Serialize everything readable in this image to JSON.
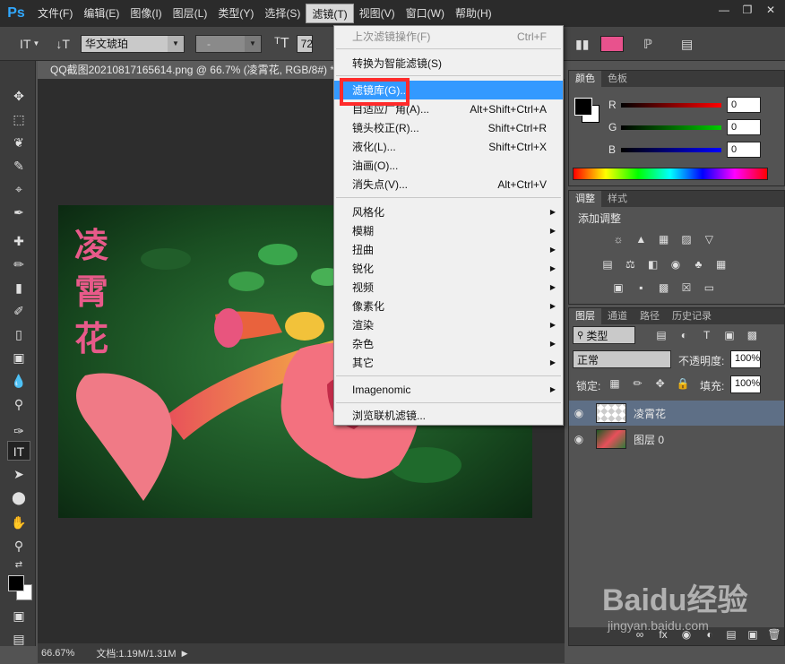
{
  "app": {
    "logo": "Ps",
    "menu": [
      "文件(F)",
      "编辑(E)",
      "图像(I)",
      "图层(L)",
      "类型(Y)",
      "选择(S)",
      "滤镜(T)",
      "视图(V)",
      "窗口(W)",
      "帮助(H)"
    ],
    "active_menu_index": 6,
    "window_controls": [
      "minimize-icon",
      "restore-icon",
      "close-icon"
    ]
  },
  "options_bar": {
    "font_family": "华文琥珀",
    "font_style": "-",
    "font_size": "72"
  },
  "document": {
    "tab_title": "QQ截图20210817165614.png @ 66.7% (凌霄花, RGB/8#) *",
    "overlay_text": "凌霄花",
    "zoom": "66.67%",
    "doc_info": "文档:1.19M/1.31M"
  },
  "filter_menu": {
    "items": [
      {
        "label": "上次滤镜操作(F)",
        "shortcut": "Ctrl+F",
        "disabled": true
      },
      {
        "label": "转换为智能滤镜(S)",
        "shortcut": ""
      },
      {
        "label": "滤镜库(G)...",
        "shortcut": "",
        "highlighted": true
      },
      {
        "label": "自适应广角(A)...",
        "shortcut": "Alt+Shift+Ctrl+A"
      },
      {
        "label": "镜头校正(R)...",
        "shortcut": "Shift+Ctrl+R"
      },
      {
        "label": "液化(L)...",
        "shortcut": "Shift+Ctrl+X"
      },
      {
        "label": "油画(O)...",
        "shortcut": ""
      },
      {
        "label": "消失点(V)...",
        "shortcut": "Alt+Ctrl+V"
      },
      {
        "label": "风格化",
        "submenu": true
      },
      {
        "label": "模糊",
        "submenu": true
      },
      {
        "label": "扭曲",
        "submenu": true
      },
      {
        "label": "锐化",
        "submenu": true
      },
      {
        "label": "视频",
        "submenu": true
      },
      {
        "label": "像素化",
        "submenu": true
      },
      {
        "label": "渲染",
        "submenu": true
      },
      {
        "label": "杂色",
        "submenu": true
      },
      {
        "label": "其它",
        "submenu": true
      },
      {
        "label": "Imagenomic",
        "submenu": true
      },
      {
        "label": "浏览联机滤镜..."
      }
    ]
  },
  "color_panel": {
    "tabs": [
      "颜色",
      "色板"
    ],
    "channels": [
      {
        "label": "R",
        "value": "0",
        "color": "#ff0000"
      },
      {
        "label": "G",
        "value": "0",
        "color": "#00cc00"
      },
      {
        "label": "B",
        "value": "0",
        "color": "#0000ff"
      }
    ]
  },
  "adjust_panel": {
    "tabs": [
      "调整",
      "样式"
    ],
    "title": "添加调整"
  },
  "layers_panel": {
    "tabs": [
      "图层",
      "通道",
      "路径",
      "历史记录"
    ],
    "filter_kind": "类型",
    "blend_mode": "正常",
    "opacity_label": "不透明度:",
    "opacity": "100%",
    "lock_label": "锁定:",
    "fill_label": "填充:",
    "fill": "100%",
    "layers": [
      {
        "name": "凌霄花",
        "selected": true
      },
      {
        "name": "图层 0",
        "selected": false
      }
    ]
  },
  "watermark": {
    "brand": "Baidu经验",
    "url": "jingyan.baidu.com"
  }
}
